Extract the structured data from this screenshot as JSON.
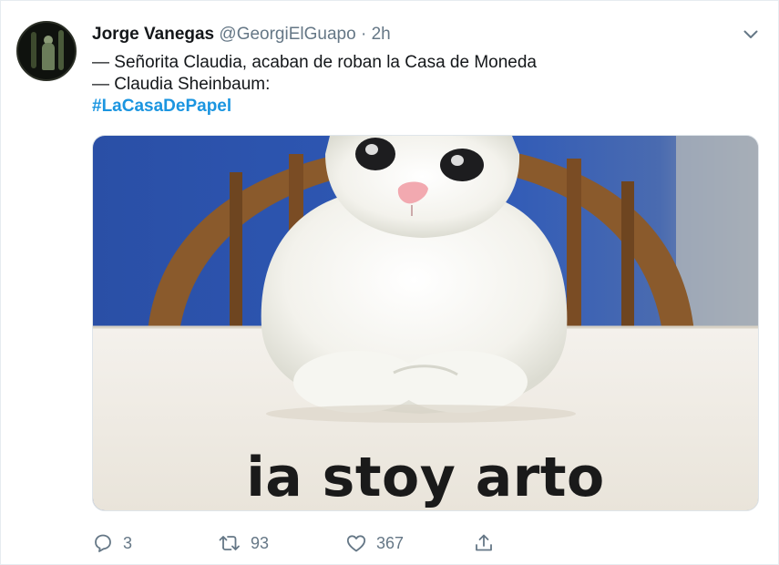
{
  "tweet": {
    "author_name": "Jorge Vanegas",
    "handle": "@GeorgiElGuapo",
    "separator": "·",
    "time": "2h",
    "lines": [
      "— Señorita Claudia, acaban de roban la Casa de Moneda",
      "— Claudia Sheinbaum:"
    ],
    "hashtag": "#LaCasaDePapel",
    "media_caption": "ia stoy arto",
    "actions": {
      "reply_count": "3",
      "retweet_count": "93",
      "like_count": "367"
    }
  },
  "icons": {
    "caret": "chevron-down-icon",
    "reply": "reply-icon",
    "retweet": "retweet-icon",
    "like": "heart-icon",
    "share": "share-icon"
  },
  "colors": {
    "link": "#1b95e0",
    "secondary_text": "#657786"
  }
}
